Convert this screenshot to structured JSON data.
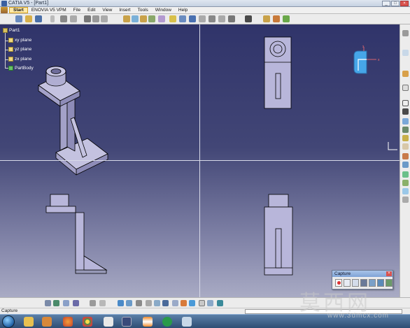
{
  "window": {
    "title": "CATIA V5 - [Part1]",
    "buttons": [
      "_",
      "□",
      "×"
    ]
  },
  "menu": {
    "items": [
      "Start",
      "ENOVIA V5 VPM",
      "File",
      "Edit",
      "View",
      "Insert",
      "Tools",
      "Window",
      "Help"
    ],
    "active": "Start"
  },
  "tree": {
    "root": "Part1",
    "items": [
      "xy plane",
      "yz plane",
      "zx plane",
      "PartBody"
    ]
  },
  "compass": {
    "axes": [
      "x",
      "y",
      "z"
    ]
  },
  "capture_panel": {
    "title": "Capture",
    "close": "×",
    "tools": [
      "record-icon",
      "select-icon",
      "options-icon",
      "capture-icon",
      "album-icon",
      "save-icon",
      "chart-icon"
    ]
  },
  "statusbar": {
    "text": "Capture",
    "command_value": ""
  },
  "watermark": {
    "text": "莫西网",
    "url": "www.3dmcx.com"
  },
  "colors": {
    "viewport_top": "#30346a",
    "viewport_bottom": "#a9abc4",
    "part_face": "#b8b6da",
    "part_edge": "#000000",
    "accent_menu": "#ffe9a8"
  }
}
